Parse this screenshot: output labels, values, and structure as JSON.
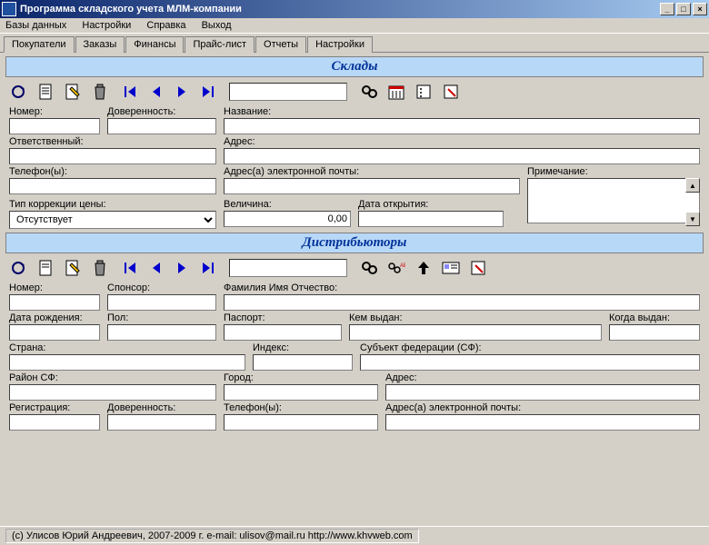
{
  "window": {
    "title": "Программа складского учета МЛМ-компании"
  },
  "menu": {
    "items": [
      "Базы данных",
      "Настройки",
      "Справка",
      "Выход"
    ]
  },
  "tabs": [
    {
      "label": "Покупатели",
      "selected": true
    },
    {
      "label": "Заказы",
      "selected": false
    },
    {
      "label": "Финансы",
      "selected": false
    },
    {
      "label": "Прайс-лист",
      "selected": false
    },
    {
      "label": "Отчеты",
      "selected": false
    },
    {
      "label": "Настройки",
      "selected": false
    }
  ],
  "sections": {
    "warehouses": {
      "title": "Склады",
      "fields": {
        "number": "Номер:",
        "proxy": "Доверенность:",
        "name": "Название:",
        "responsible": "Ответственный:",
        "address": "Адрес:",
        "phones": "Телефон(ы):",
        "emails": "Адрес(а) электронной почты:",
        "note": "Примечание:",
        "price_correction_type": "Тип коррекции цены:",
        "magnitude": "Величина:",
        "open_date": "Дата открытия:"
      },
      "values": {
        "price_correction_type": "Отсутствует",
        "magnitude": "0,00"
      }
    },
    "distributors": {
      "title": "Дистрибьюторы",
      "fields": {
        "number": "Номер:",
        "sponsor": "Спонсор:",
        "fio": "Фамилия Имя Отчество:",
        "birthdate": "Дата рождения:",
        "sex": "Пол:",
        "passport": "Паспорт:",
        "issued_by": "Кем выдан:",
        "issued_when": "Когда выдан:",
        "country": "Страна:",
        "index": "Индекс:",
        "fed_subject": "Субъект федерации (СФ):",
        "district": "Район СФ:",
        "city": "Город:",
        "address": "Адрес:",
        "registration": "Регистрация:",
        "proxy": "Доверенность:",
        "phones": "Телефон(ы):",
        "emails": "Адрес(а) электронной почты:"
      }
    }
  },
  "status": {
    "copyright": "(c) Улисов Юрий Андреевич, 2007-2009 г.   e-mail: ulisov@mail.ru    http://www.khvweb.com"
  }
}
